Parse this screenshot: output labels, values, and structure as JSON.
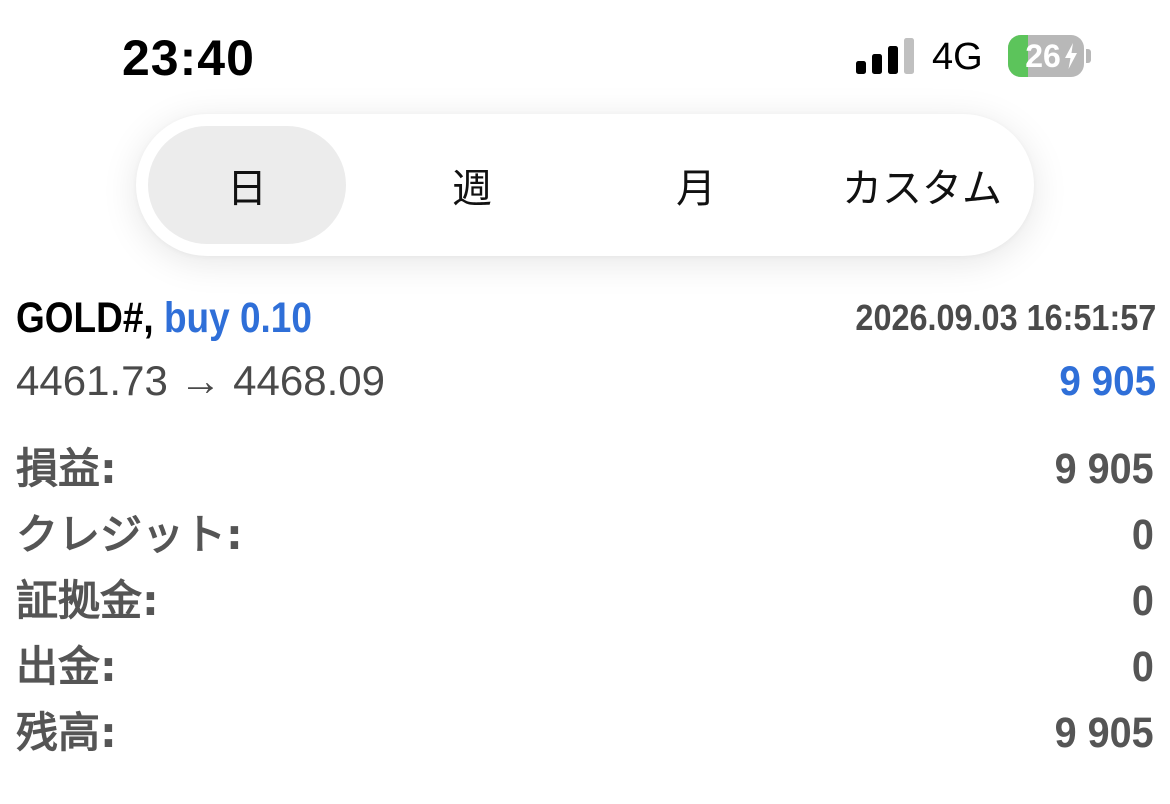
{
  "status_bar": {
    "time": "23:40",
    "network": "4G",
    "battery_level": "26",
    "battery_percent": 26,
    "icons": [
      "cellular-signal-icon",
      "battery-icon",
      "charging-bolt-icon"
    ]
  },
  "colors": {
    "accent_blue": "#2f6fd8",
    "battery_green": "#5cc45b",
    "segment_active": "#ececec",
    "label_gray": "#555555"
  },
  "period_tabs": [
    {
      "label": "日",
      "active": true
    },
    {
      "label": "週",
      "active": false
    },
    {
      "label": "月",
      "active": false
    },
    {
      "label": "カスタム",
      "active": false
    }
  ],
  "trade": {
    "symbol": "GOLD#,",
    "direction": "buy 0.10",
    "datetime": "2026.09.03 16:51:57",
    "prices": "4461.73 → 4468.09",
    "profit": "9 905"
  },
  "summary": [
    {
      "label": "損益:",
      "value": "9 905"
    },
    {
      "label": "クレジット:",
      "value": "0"
    },
    {
      "label": "証拠金:",
      "value": "0"
    },
    {
      "label": "出金:",
      "value": "0"
    },
    {
      "label": "残高:",
      "value": "9 905"
    }
  ]
}
